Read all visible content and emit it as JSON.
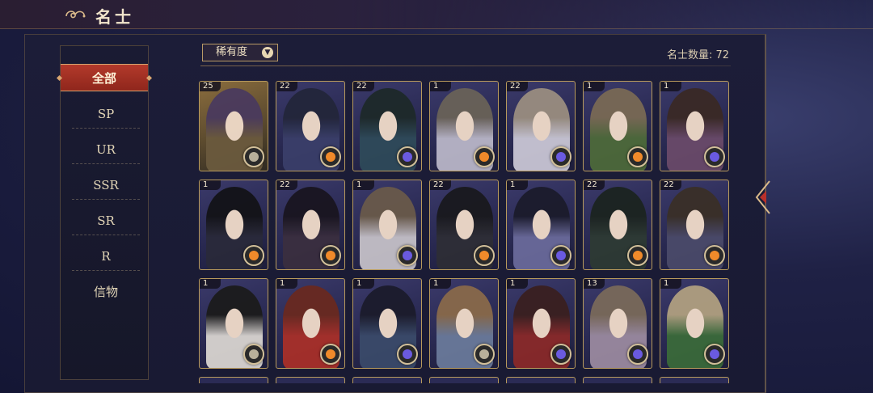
{
  "header": {
    "title": "名士"
  },
  "sidebar": {
    "items": [
      {
        "label": "全部",
        "active": true
      },
      {
        "label": "SP"
      },
      {
        "label": "UR"
      },
      {
        "label": "SSR"
      },
      {
        "label": "SR"
      },
      {
        "label": "R"
      },
      {
        "label": "信物"
      }
    ]
  },
  "toolbar": {
    "filter_label": "稀有度",
    "count_text": "名士数量: 72"
  },
  "cards": [
    {
      "level": "25",
      "element": "dark",
      "hair": "#4a3a5e",
      "robe": "#6b5a3e",
      "gold": true
    },
    {
      "level": "22",
      "element": "fire",
      "hair": "#23263a",
      "robe": "#3a3f6a"
    },
    {
      "level": "22",
      "element": "water",
      "hair": "#1e2a2a",
      "robe": "#2f4a5a"
    },
    {
      "level": "1",
      "element": "fire",
      "hair": "#6a6258",
      "robe": "#b9b6c8"
    },
    {
      "level": "22",
      "element": "water",
      "hair": "#9a8e80",
      "robe": "#c9c6d4"
    },
    {
      "level": "1",
      "element": "fire",
      "hair": "#7a6a55",
      "robe": "#4d6a3a"
    },
    {
      "level": "1",
      "element": "water",
      "hair": "#3a2a25",
      "robe": "#6a4a6a"
    },
    {
      "level": "1",
      "element": "fire",
      "hair": "#141418",
      "robe": "#2a2a3a"
    },
    {
      "level": "22",
      "element": "fire",
      "hair": "#1a1620",
      "robe": "#3a2f40"
    },
    {
      "level": "1",
      "element": "water",
      "hair": "#6a5a4a",
      "robe": "#c4c0c8"
    },
    {
      "level": "22",
      "element": "fire",
      "hair": "#1a1a1e",
      "robe": "#2e2e36"
    },
    {
      "level": "1",
      "element": "water",
      "hair": "#1c1c2c",
      "robe": "#6a6a9a"
    },
    {
      "level": "22",
      "element": "fire",
      "hair": "#1c2420",
      "robe": "#2e3a34"
    },
    {
      "level": "22",
      "element": "fire",
      "hair": "#3a3028",
      "robe": "#4a4a6a"
    },
    {
      "level": "1",
      "element": "dark",
      "hair": "#1c1c1c",
      "robe": "#d8d4d0"
    },
    {
      "level": "1",
      "element": "fire",
      "hair": "#6a2a20",
      "robe": "#a8302a"
    },
    {
      "level": "1",
      "element": "water",
      "hair": "#1c1c2c",
      "robe": "#3a4a6a"
    },
    {
      "level": "1",
      "element": "dark",
      "hair": "#8a6a4a",
      "robe": "#6a7a9a"
    },
    {
      "level": "1",
      "element": "water",
      "hair": "#3a2020",
      "robe": "#8a2a2a"
    },
    {
      "level": "13",
      "element": "water",
      "hair": "#7a6a5a",
      "robe": "#9a8aa0"
    },
    {
      "level": "1",
      "element": "water",
      "hair": "#b0a080",
      "robe": "#3a6a3a"
    }
  ],
  "element_colors": {
    "fire": "#f08a2a",
    "water": "#6a5ae0",
    "dark": "#b8b09a"
  }
}
